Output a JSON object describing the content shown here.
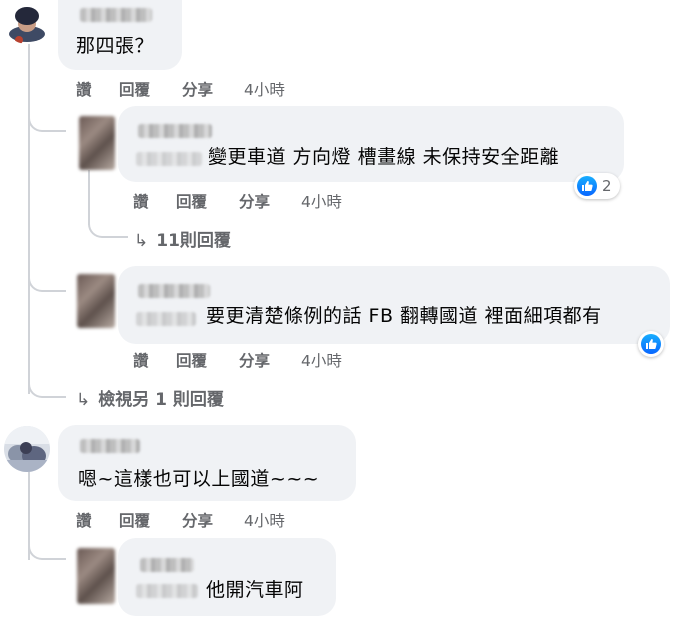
{
  "comments": [
    {
      "text": "那四張？",
      "actions": {
        "like": "讚",
        "reply": "回覆",
        "share": "分享",
        "time": "4小時"
      },
      "replies": [
        {
          "text": "變更車道 方向燈 槽畫線 未保持安全距離",
          "actions": {
            "like": "讚",
            "reply": "回覆",
            "share": "分享",
            "time": "4小時"
          },
          "reaction": {
            "icon": "like-icon",
            "count": "2"
          },
          "more_replies": "11則回覆"
        },
        {
          "text": "要更清楚條例的話 FB 翻轉國道 裡面細項都有",
          "actions": {
            "like": "讚",
            "reply": "回覆",
            "share": "分享",
            "time": "4小時"
          },
          "reaction": {
            "icon": "like-icon"
          }
        }
      ],
      "view_more": "檢視另 1 則回覆"
    },
    {
      "text": "嗯~這樣也可以上國道~~~",
      "actions": {
        "like": "讚",
        "reply": "回覆",
        "share": "分享",
        "time": "4小時"
      },
      "replies": [
        {
          "text": "他開汽車阿"
        }
      ]
    }
  ],
  "colors": {
    "bubble": "#f0f2f5",
    "meta_text": "#65676b",
    "like_blue": "#0866ff",
    "thread_line": "#d0d3d8"
  }
}
